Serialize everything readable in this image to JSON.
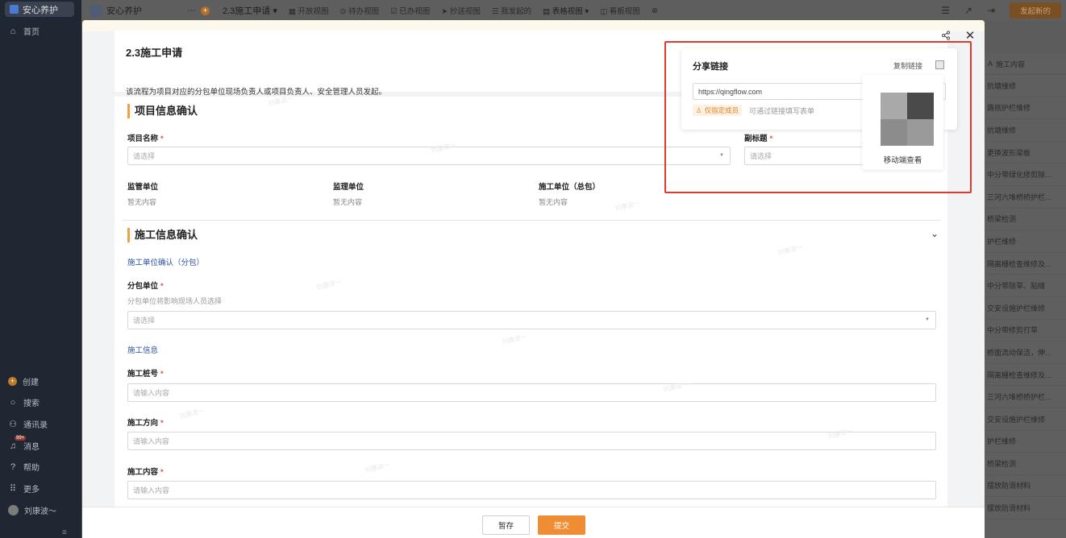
{
  "sidebar": {
    "workspace": "安心养护",
    "items": {
      "home": "首页",
      "create": "创建",
      "search": "搜索",
      "contacts": "通讯录",
      "messages": "消息",
      "help": "帮助",
      "more": "更多",
      "user": "刘康波～"
    },
    "badge": "99+"
  },
  "topbar": {
    "app_name": "安心养护",
    "more": "···",
    "form_name": "2.3施工申请",
    "views": [
      "开放视图",
      "待办视图",
      "已办视图",
      "抄送视图",
      "我发起的",
      "表格视图",
      "看板视图"
    ],
    "active_view": "表格视图",
    "new_button": "发起新的"
  },
  "bglist": {
    "header": "施工内容",
    "rows": [
      "抗塘维修",
      "路侧护栏维修",
      "抗塘维修",
      "更换波形梁板",
      "中分带绿化修剪除...",
      "三河六堆桥桥护栏...",
      "桥梁检测",
      "护栏维修",
      "隔离栅检查维修及...",
      "中分带除草、贴缝",
      "交安设施护栏维修",
      "中分带修剪打草",
      "桥面流动保洁，伸...",
      "隔离栅检查维修及...",
      "三河六堆桥桥护栏...",
      "交安设施护栏维修",
      "护栏维修",
      "桥梁检测",
      "摆放防滑材料",
      "摆放防滑材料"
    ]
  },
  "form": {
    "title": "2.3施工申请",
    "description": "该流程为项目对应的分包单位现场负责人或项目负责人、安全管理人员发起。",
    "sections": {
      "project": {
        "title": "项目信息确认",
        "project_name_label": "项目名称",
        "project_name_placeholder": "请选择",
        "subtitle_label": "副标题",
        "subtitle_placeholder": "请选择",
        "supervisor_label": "监管单位",
        "supervisor_value": "暂无内容",
        "inspector_label": "监理单位",
        "inspector_value": "暂无内容",
        "contractor_label": "施工单位（总包）",
        "contractor_value": "暂无内容"
      },
      "construction": {
        "title": "施工信息确认",
        "sub1": "施工单位确认（分包）",
        "subcontractor_label": "分包单位",
        "subcontractor_hint": "分包单位将影响现场人员选择",
        "subcontractor_placeholder": "请选择",
        "sub2": "施工信息",
        "pile_label": "施工桩号",
        "pile_placeholder": "请输入内容",
        "direction_label": "施工方向",
        "direction_placeholder": "请输入内容",
        "content_label": "施工内容",
        "content_placeholder": "请输入内容"
      }
    },
    "watermark": "刘康波～"
  },
  "footer": {
    "save": "暂存",
    "submit": "提交"
  },
  "share": {
    "title": "分享链接",
    "copy_link": "复制链接",
    "url": "https://qingflow.com",
    "member_tag": "仅指定成员",
    "member_note": "可通过链接填写表单",
    "qr_label": "移动端查看"
  },
  "colors": {
    "accent": "#f08c33",
    "highlight": "#e03a2f",
    "link": "#2c4fa3"
  }
}
